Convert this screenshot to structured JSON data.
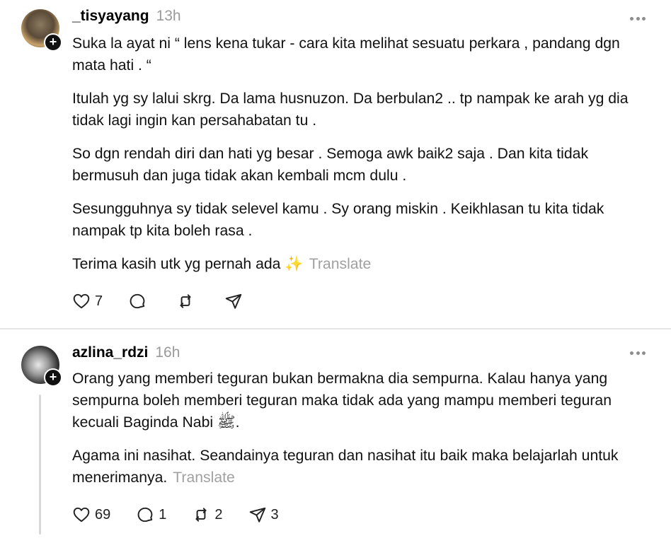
{
  "posts": [
    {
      "username": "_tisyayang",
      "time": "13h",
      "paragraphs": [
        "Suka la ayat ni “ lens kena tukar - cara kita melihat sesuatu perkara , pandang dgn mata hati . “",
        "Itulah yg sy lalui skrg. Da lama husnuzon. Da berbulan2 .. tp nampak ke arah yg dia tidak lagi ingin kan persahabatan tu .",
        "So dgn rendah diri dan hati yg besar . Semoga awk baik2 saja . Dan kita tidak bermusuh dan juga tidak akan kembali mcm dulu .",
        "Sesungguhnya sy tidak selevel kamu . Sy orang miskin . Keikhlasan tu kita tidak nampak tp kita boleh rasa .",
        "Terima kasih utk yg pernah ada ✨"
      ],
      "translate": "Translate",
      "likes": "7",
      "replies": "",
      "reposts": "",
      "shares": ""
    },
    {
      "username": "azlina_rdzi",
      "time": "16h",
      "paragraphs": [
        "Orang yang memberi teguran bukan bermakna dia sempurna. Kalau hanya yang sempurna boleh memberi teguran maka tidak ada yang mampu memberi teguran kecuali Baginda Nabi ﷺ.",
        "Agama ini nasihat. Seandainya teguran dan nasihat itu baik maka belajarlah untuk menerimanya."
      ],
      "translate": "Translate",
      "likes": "69",
      "replies": "1",
      "reposts": "2",
      "shares": "3"
    }
  ],
  "icons": {
    "like": "heart-icon",
    "reply": "comment-icon",
    "repost": "repost-icon",
    "share": "send-icon",
    "more": "more-options-icon",
    "follow": "follow-plus-icon"
  },
  "colors": {
    "text": "#111111",
    "muted": "#9a9a9a",
    "divider": "#e4e4e4"
  }
}
